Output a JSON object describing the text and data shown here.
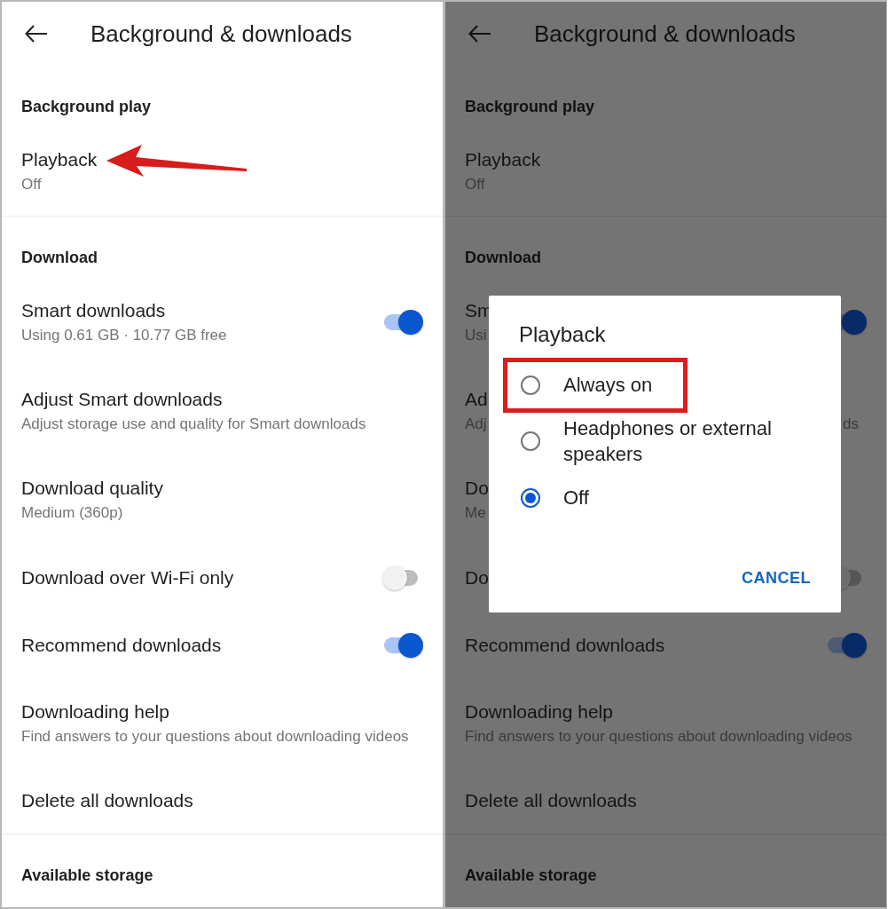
{
  "screens": [
    {
      "title": "Background & downloads",
      "dimmed": false,
      "items": [
        {
          "kind": "section",
          "title": "Background play"
        },
        {
          "kind": "item",
          "title": "Playback",
          "subtitle": "Off",
          "arrow": true
        },
        {
          "kind": "divider"
        },
        {
          "kind": "section",
          "title": "Download"
        },
        {
          "kind": "toggle",
          "title": "Smart downloads",
          "subtitle": "Using 0.61 GB · 10.77 GB free",
          "on": true
        },
        {
          "kind": "item",
          "title": "Adjust Smart downloads",
          "subtitle": "Adjust storage use and quality for Smart downloads"
        },
        {
          "kind": "item",
          "title": "Download quality",
          "subtitle": "Medium (360p)"
        },
        {
          "kind": "toggle",
          "title": "Download over Wi-Fi only",
          "on": false
        },
        {
          "kind": "toggle",
          "title": "Recommend downloads",
          "on": true
        },
        {
          "kind": "item",
          "title": "Downloading help",
          "subtitle": "Find answers to your questions about downloading videos"
        },
        {
          "kind": "item",
          "title": "Delete all downloads"
        },
        {
          "kind": "divider"
        },
        {
          "kind": "section",
          "title": "Available storage"
        }
      ]
    },
    {
      "title": "Background & downloads",
      "dimmed": true,
      "items": [
        {
          "kind": "section",
          "title": "Background play"
        },
        {
          "kind": "item",
          "title": "Playback",
          "subtitle": "Off"
        },
        {
          "kind": "divider"
        },
        {
          "kind": "section",
          "title": "Download"
        },
        {
          "kind": "toggle",
          "title": "Sm",
          "subtitle": "Usi",
          "on": true
        },
        {
          "kind": "item",
          "title": "Ad",
          "subtitle": "Adj",
          "subtitle_end": "ds"
        },
        {
          "kind": "item",
          "title": "Do",
          "subtitle": "Me"
        },
        {
          "kind": "toggle",
          "title": "Do",
          "on": false
        },
        {
          "kind": "toggle",
          "title": "Recommend downloads",
          "on": true
        },
        {
          "kind": "item",
          "title": "Downloading help",
          "subtitle": "Find answers to your questions about downloading videos"
        },
        {
          "kind": "item",
          "title": "Delete all downloads"
        },
        {
          "kind": "divider"
        },
        {
          "kind": "section",
          "title": "Available storage"
        }
      ],
      "dialog": {
        "title": "Playback",
        "options": [
          {
            "label": "Always on",
            "selected": false,
            "highlighted": true
          },
          {
            "label": "Headphones or external speakers",
            "selected": false,
            "highlighted": false
          },
          {
            "label": "Off",
            "selected": true,
            "highlighted": false
          }
        ],
        "button": "CANCEL"
      }
    }
  ]
}
